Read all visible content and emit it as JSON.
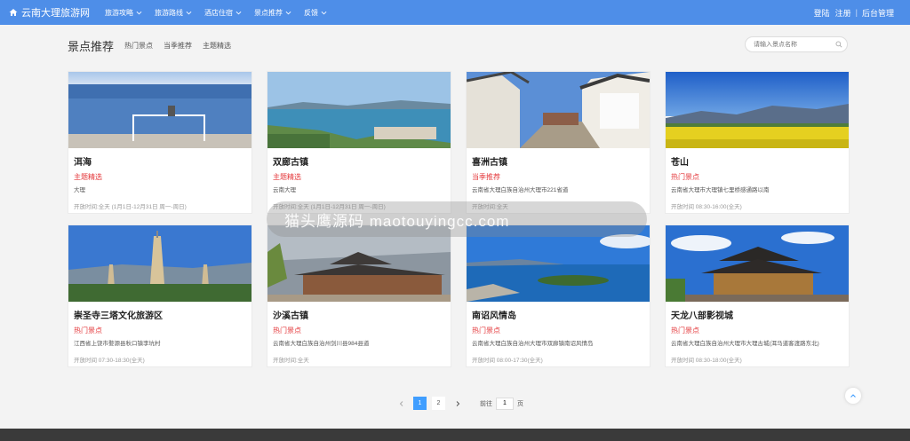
{
  "nav": {
    "brand": "云南大理旅游网",
    "menu": [
      "旅游攻略",
      "旅游路线",
      "酒店住宿",
      "景点推荐",
      "反馈"
    ],
    "login": "登陆",
    "register": "注册",
    "admin": "后台管理",
    "color": "#4e8ee8"
  },
  "header": {
    "title": "景点推荐",
    "tabs": [
      "热门景点",
      "当季推荐",
      "主题精选"
    ],
    "search_placeholder": "请输入景点名称"
  },
  "cards": [
    {
      "name": "洱海",
      "tag": "主题精选",
      "addr": "大理",
      "hours": "开放时间:全天 (1月1日-12月31日 周一-周日)"
    },
    {
      "name": "双廊古镇",
      "tag": "主题精选",
      "addr": "云南大理",
      "hours": "开放时间:全天 (1月1日-12月31日 周一-周日)"
    },
    {
      "name": "喜洲古镇",
      "tag": "当季推荐",
      "addr": "云南省大理白族自治州大理市221省道",
      "hours": "开放时间:全天"
    },
    {
      "name": "苍山",
      "tag": "热门景点",
      "addr": "云南省大理市大理镇七里桥感通路以南",
      "hours": "开放时间 08:30-16:00(全天)"
    },
    {
      "name": "崇圣寺三塔文化旅游区",
      "tag": "热门景点",
      "addr": "江西省上饶市婺源县秋口镇李坑村",
      "hours": "开放时间 07:30-18:30(全天)"
    },
    {
      "name": "沙溪古镇",
      "tag": "热门景点",
      "addr": "云南省大理白族自治州剑川县984县道",
      "hours": "开放时间:全天"
    },
    {
      "name": "南诏风情岛",
      "tag": "热门景点",
      "addr": "云南省大理白族自治州大理市双廊镇南诏风情岛",
      "hours": "开放时间 08:00-17:30(全天)"
    },
    {
      "name": "天龙八部影视城",
      "tag": "热门景点",
      "addr": "云南省大理白族自治州大理市大理古城(洱马道客渡路东北)",
      "hours": "开放时间 08:30-18:00(全天)"
    }
  ],
  "pager": {
    "pages": [
      "1",
      "2"
    ],
    "goto": "前往",
    "current": "1",
    "unit": "页"
  },
  "watermark": "猫头鹰源码 maotouyingcc.com"
}
